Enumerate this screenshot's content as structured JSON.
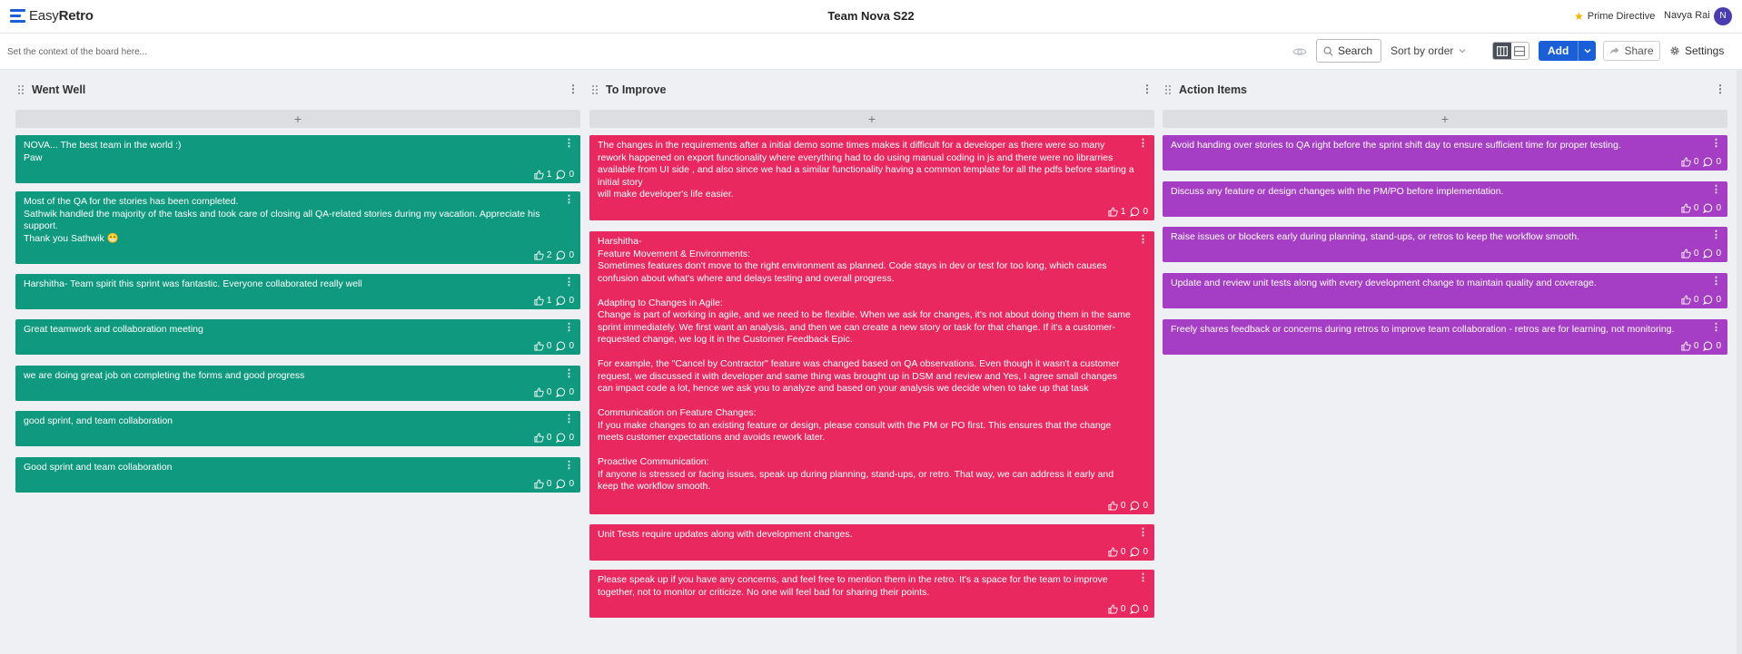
{
  "app": {
    "logo_light": "Easy",
    "logo_bold": "Retro",
    "brand_color": "#1a5fd8"
  },
  "header": {
    "board_title": "Team Nova S22",
    "prime_directive": "Prime Directive",
    "user_name": "Navya Rai",
    "user_initial": "N"
  },
  "toolbar": {
    "context_placeholder": "Set the context of the board here...",
    "search_label": "Search",
    "sort_label": "Sort by order",
    "add_label": "Add",
    "share_label": "Share",
    "settings_label": "Settings"
  },
  "columns": [
    {
      "title": "Went Well",
      "color": "#0f9a7f",
      "add_label": "+",
      "cards": [
        {
          "text": "NOVA... The best team in the world :)\nPaw",
          "likes": "1",
          "comments": "0"
        },
        {
          "text": "Most of the QA for the stories has been completed.\nSathwik handled the majority of the tasks and took care of closing all QA-related stories during my vacation. Appreciate his support.\nThank you Sathwik 😁",
          "likes": "2",
          "comments": "0"
        },
        {
          "text": "Harshitha- Team spirit this sprint was fantastic. Everyone collaborated really well",
          "likes": "1",
          "comments": "0"
        },
        {
          "text": "Great teamwork and collaboration meeting",
          "likes": "0",
          "comments": "0"
        },
        {
          "text": "we are doing great job on completing the forms and good progress",
          "likes": "0",
          "comments": "0"
        },
        {
          "text": "good sprint, and team collaboration",
          "likes": "0",
          "comments": "0"
        },
        {
          "text": "Good sprint and team collaboration",
          "likes": "0",
          "comments": "0"
        }
      ]
    },
    {
      "title": "To Improve",
      "color": "#e8285f",
      "add_label": "+",
      "cards": [
        {
          "text": "The changes in the requirements after a initial demo some times makes it difficult for a developer as there were so many rework happened on export functionality where everything had to do using manual coding in js and there were no librarries available from UI side , and also since we had a similar functionality having a common template for all the pdfs before starting a initial story\nwill make developer's life easier.",
          "likes": "1",
          "comments": "0"
        },
        {
          "text": "Harshitha-\nFeature Movement & Environments:\nSometimes features don't move to the right environment as planned. Code stays in dev or test for too long, which causes confusion about what's where and delays testing and overall progress.\n\nAdapting to Changes in Agile:\nChange is part of working in agile, and we need to be flexible. When we ask for changes, it's not about doing them in the same sprint immediately. We first want an analysis, and then we can create a new story or task for that change. If it's a customer-requested change, we log it in the Customer Feedback Epic.\n\nFor example, the \"Cancel by Contractor\" feature was changed based on QA observations. Even though it wasn't a customer request, we discussed it with developer and same thing was brought up in DSM and review and Yes, I agree small changes can impact code a lot, hence we ask you to analyze and based on your analysis we decide when to take up that task\n\nCommunication on Feature Changes:\nIf you make changes to an existing feature or design, please consult with the PM or PO first. This ensures that the change meets customer expectations and avoids rework later.\n\nProactive Communication:\nIf anyone is stressed or facing issues, speak up during planning, stand-ups, or retro. That way, we can address it early and keep the workflow smooth.",
          "likes": "0",
          "comments": "0"
        },
        {
          "text": "Unit Tests require updates along with development changes.",
          "likes": "0",
          "comments": "0"
        },
        {
          "text": "Please speak up if you have any concerns, and feel free to mention them in the retro. It's a space for the team to improve together, not to monitor or criticize. No one will feel bad for sharing their points.",
          "likes": "0",
          "comments": "0"
        }
      ]
    },
    {
      "title": "Action Items",
      "color": "#a53ec4",
      "add_label": "+",
      "cards": [
        {
          "text": "Avoid handing over stories to QA right before the sprint shift day to ensure sufficient time for proper testing.",
          "likes": "0",
          "comments": "0"
        },
        {
          "text": "Discuss any feature or design changes with the PM/PO before implementation.",
          "likes": "0",
          "comments": "0"
        },
        {
          "text": "Raise issues or blockers early during planning, stand-ups, or retros to keep the workflow smooth.",
          "likes": "0",
          "comments": "0"
        },
        {
          "text": "Update and review unit tests along with every development change to maintain quality and coverage.",
          "likes": "0",
          "comments": "0"
        },
        {
          "text": "Freely shares feedback or concerns during retros to improve team collaboration - retros are for learning, not monitoring.",
          "likes": "0",
          "comments": "0"
        }
      ]
    }
  ]
}
